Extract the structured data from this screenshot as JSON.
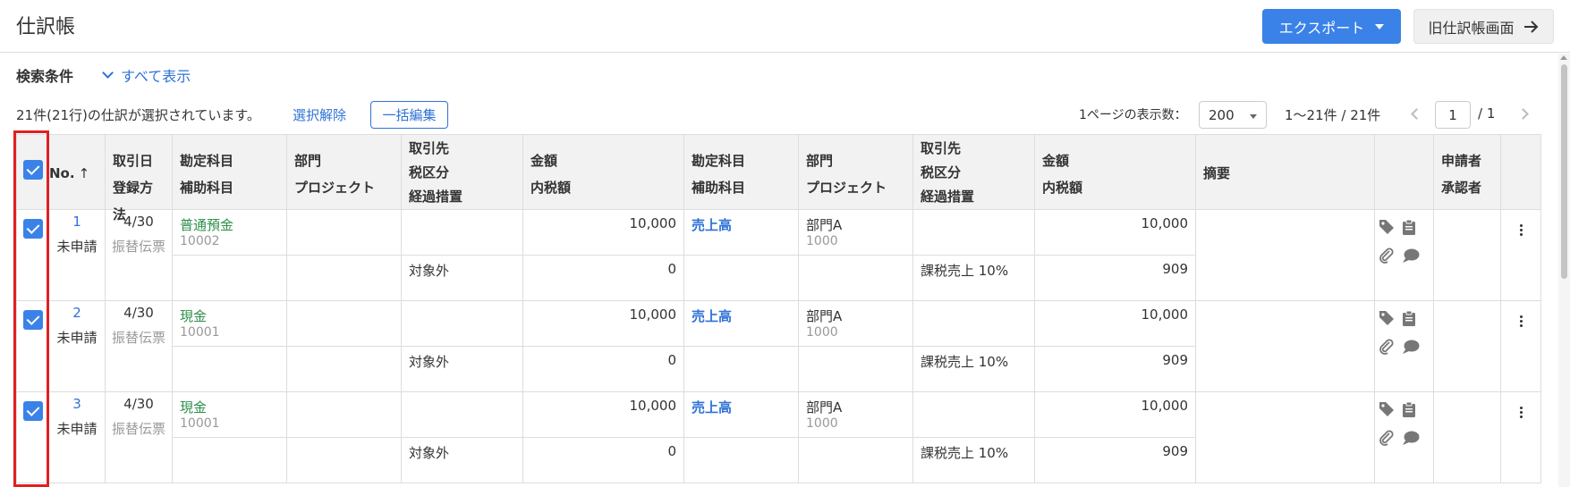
{
  "header": {
    "title": "仕訳帳",
    "export_label": "エクスポート",
    "old_screen_label": "旧仕訳帳画面",
    "accent": "#3b82e8"
  },
  "search": {
    "conditions_label": "検索条件",
    "show_all_label": "すべて表示"
  },
  "selection": {
    "info": "21件(21行)の仕訳が選択されています。",
    "clear_label": "選択解除",
    "bulk_edit_label": "一括編集"
  },
  "pagination": {
    "per_page_label": "1ページの表示数：",
    "per_page_value": "200",
    "range": "1〜21件 / 21件",
    "current_page": "1",
    "total_pages": "/ 1"
  },
  "columns": {
    "no": "No.",
    "date": "取引日",
    "reg_method": "登録方法",
    "debit_account": "勘定科目",
    "debit_sub": "補助科目",
    "debit_dept": "部門",
    "debit_project": "プロジェクト",
    "debit_partner": "取引先",
    "debit_tax": "税区分",
    "debit_transition": "経過措置",
    "debit_amount": "金額",
    "debit_tax_incl": "内税額",
    "credit_account": "勘定科目",
    "credit_sub": "補助科目",
    "credit_dept": "部門",
    "credit_project": "プロジェクト",
    "credit_partner": "取引先",
    "credit_tax": "税区分",
    "credit_transition": "経過措置",
    "credit_amount": "金額",
    "credit_tax_incl": "内税額",
    "memo": "摘要",
    "applicant": "申請者",
    "approver": "承認者"
  },
  "rows": [
    {
      "no": "1",
      "status": "未申請",
      "date": "4/30",
      "method": "振替伝票",
      "debit_account": "普通預金",
      "debit_code": "10002",
      "debit_tax": "対象外",
      "debit_amount": "10,000",
      "debit_tax_amount": "0",
      "credit_account": "売上高",
      "credit_dept": "部門A",
      "credit_dept_code": "1000",
      "credit_tax": "課税売上 10%",
      "credit_amount": "10,000",
      "credit_tax_amount": "909"
    },
    {
      "no": "2",
      "status": "未申請",
      "date": "4/30",
      "method": "振替伝票",
      "debit_account": "現金",
      "debit_code": "10001",
      "debit_tax": "対象外",
      "debit_amount": "10,000",
      "debit_tax_amount": "0",
      "credit_account": "売上高",
      "credit_dept": "部門A",
      "credit_dept_code": "1000",
      "credit_tax": "課税売上 10%",
      "credit_amount": "10,000",
      "credit_tax_amount": "909"
    },
    {
      "no": "3",
      "status": "未申請",
      "date": "4/30",
      "method": "振替伝票",
      "debit_account": "現金",
      "debit_code": "10001",
      "debit_tax": "対象外",
      "debit_amount": "10,000",
      "debit_tax_amount": "0",
      "credit_account": "売上高",
      "credit_dept": "部門A",
      "credit_dept_code": "1000",
      "credit_tax": "課税売上 10%",
      "credit_amount": "10,000",
      "credit_tax_amount": "909"
    }
  ],
  "icons": [
    "tag-icon",
    "clipboard-icon",
    "paperclip-icon",
    "comment-icon",
    "more-vertical-icon"
  ]
}
